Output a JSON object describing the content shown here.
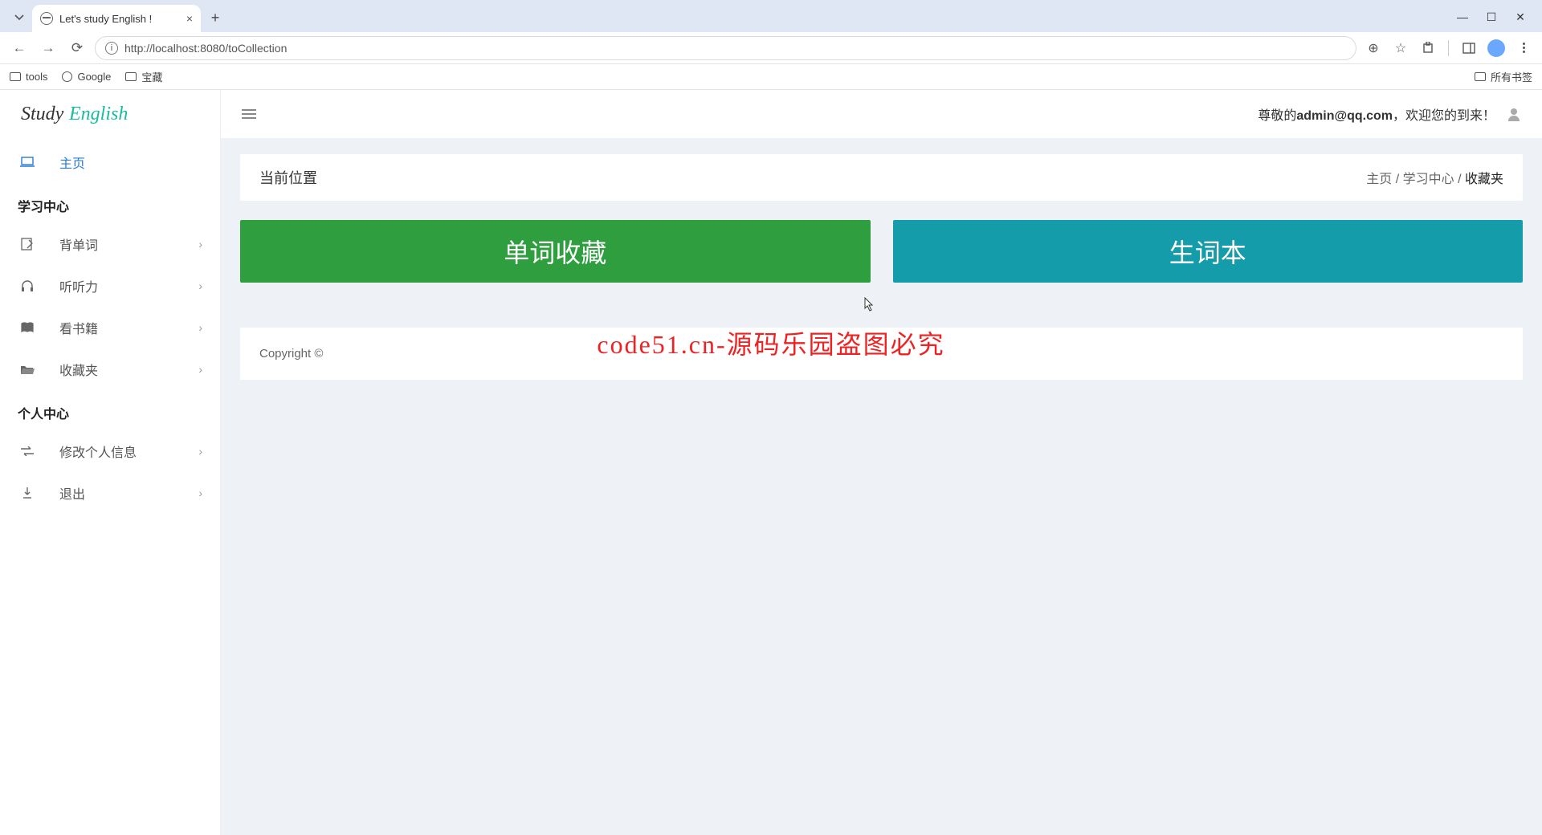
{
  "browser": {
    "tab_title": "Let's study English !",
    "url": "http://localhost:8080/toCollection",
    "bookmarks": [
      "tools",
      "Google",
      "宝藏"
    ],
    "all_bookmarks": "所有书签"
  },
  "logo": {
    "part1": "Study",
    "part2": "English"
  },
  "sidebar": {
    "home": "主页",
    "group1": "学习中心",
    "items1": [
      "背单词",
      "听听力",
      "看书籍",
      "收藏夹"
    ],
    "group2": "个人中心",
    "items2": [
      "修改个人信息",
      "退出"
    ]
  },
  "header": {
    "prefix": "尊敬的",
    "user": "admin@qq.com",
    "suffix": "，欢迎您的到来！"
  },
  "breadcrumb": {
    "title": "当前位置",
    "links": [
      "主页",
      "学习中心"
    ],
    "current": "收藏夹",
    "sep": " / "
  },
  "cards": {
    "green": "单词收藏",
    "teal": "生词本"
  },
  "footer": "Copyright ©",
  "watermark": "code51.cn",
  "overlay": "code51.cn-源码乐园盗图必究"
}
